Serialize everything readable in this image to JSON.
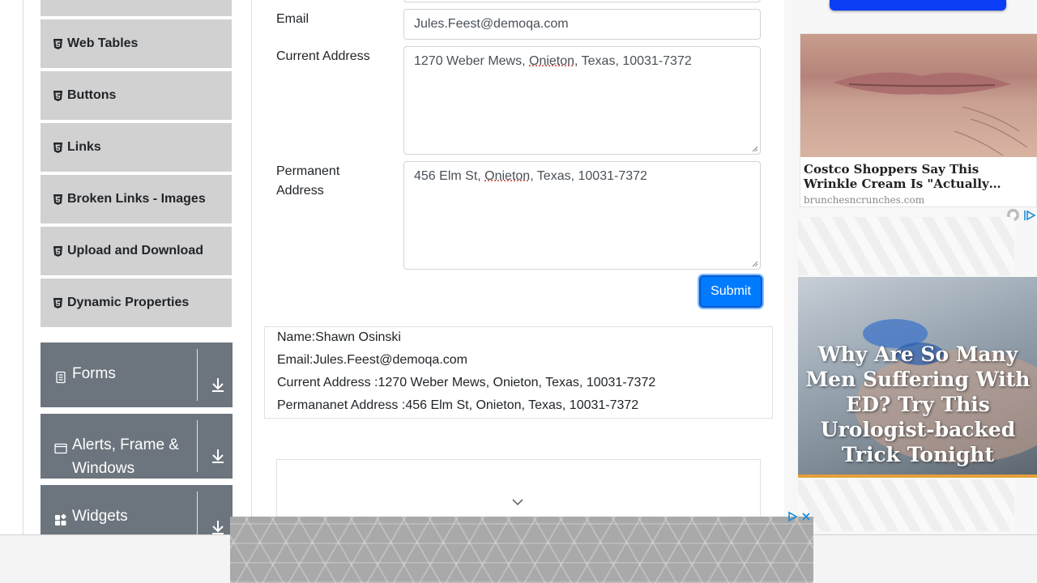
{
  "sidebar": {
    "items": [
      {
        "label": "Web Tables"
      },
      {
        "label": "Buttons"
      },
      {
        "label": "Links"
      },
      {
        "label": "Broken Links - Images"
      },
      {
        "label": "Upload and Download"
      },
      {
        "label": "Dynamic Properties"
      }
    ],
    "groups": [
      {
        "label": "Forms",
        "icon": "form-icon"
      },
      {
        "label": "Alerts, Frame &",
        "label2": "Windows",
        "icon": "window-icon"
      },
      {
        "label": "Widgets",
        "icon": "widgets-icon"
      }
    ]
  },
  "form": {
    "email_label": "Email",
    "email_value": "Jules.Feest@demoqa.com",
    "current_address_label": "Current Address",
    "current_address": {
      "prefix": "1270 Weber Mews, ",
      "city": "Onieton",
      "suffix": ", Texas, 10031-7372"
    },
    "permanent_address_label_1": "Permanent",
    "permanent_address_label_2": "Address",
    "permanent_address": {
      "prefix": "456 Elm St, ",
      "city": "Onieton",
      "suffix": ", Texas, 10031-7372"
    },
    "submit_label": "Submit"
  },
  "output": {
    "name": "Name:Shawn Osinski",
    "email": "Email:Jules.Feest@demoqa.com",
    "current_address": "Current Address :1270 Weber Mews, Onieton, Texas, 10031-7372",
    "permanent_address": "Permananet Address :456 Elm St, Onieton, Texas, 10031-7372"
  },
  "ads": {
    "wrinkle_title": "Costco Shoppers Say This Wrinkle Cream Is \"Actually…",
    "wrinkle_source": "brunchesncrunches.com",
    "ed_title": "Why Are So Many Men Suffering With ED? Try This Urologist-backed Trick Tonight"
  },
  "colors": {
    "accent": "#007bff",
    "sidebar_item": "#d1d1d1",
    "group": "#6c757d"
  }
}
